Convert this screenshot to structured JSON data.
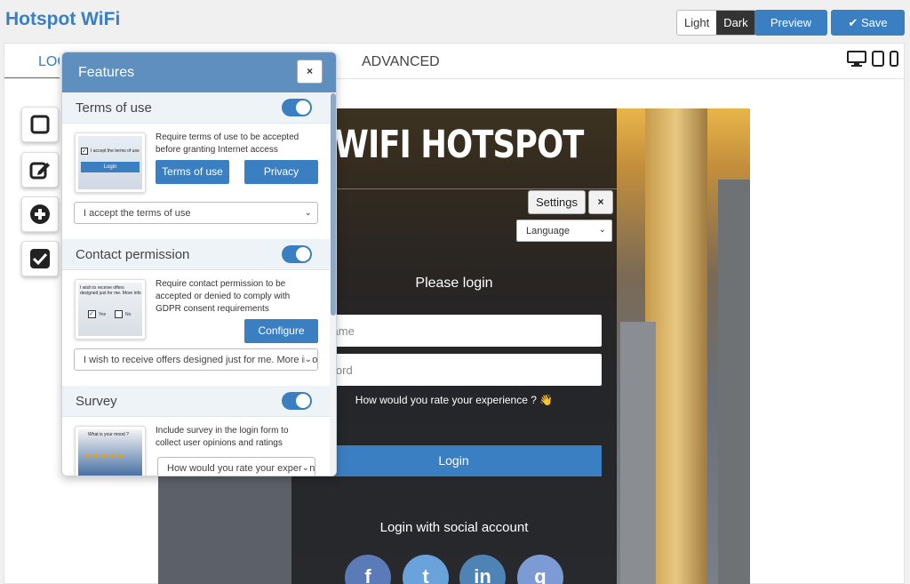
{
  "app": {
    "title": "Hotspot WiFi"
  },
  "theme": {
    "light": "Light",
    "dark": "Dark"
  },
  "toolbar": {
    "preview": "Preview",
    "save": "Save"
  },
  "tabs": {
    "login": "LOG",
    "advanced": "ADVANCED"
  },
  "preview": {
    "logo_text": "WIFI HOTSPOT",
    "settings": "Settings",
    "close": "×",
    "language": "Language",
    "please_login": "Please login",
    "username_placeholder": "rname",
    "password_placeholder": "sword",
    "rate_question": "How would you rate your experience ? 👋",
    "login_button": "Login",
    "social_title": "Login with social account",
    "social": [
      "f",
      "t",
      "in",
      "g"
    ]
  },
  "features": {
    "title": "Features",
    "close": "×",
    "sections": [
      {
        "title": "Terms of use",
        "description": "Require terms of use to be accepted before granting Internet access",
        "buttons": [
          "Terms of use",
          "Privacy"
        ],
        "select_value": "I accept the terms of use",
        "thumb_text": "I accept the terms of use",
        "thumb_button": "Login"
      },
      {
        "title": "Contact permission",
        "description": "Require contact permission to be accepted or denied to comply with GDPR consent requirements",
        "buttons": [
          "Configure"
        ],
        "select_value": "I wish to receive offers designed just for me. More info",
        "thumb_text": "I wish to receive offers designed just for me. More info",
        "thumb_yes": "Yes",
        "thumb_no": "No"
      },
      {
        "title": "Survey",
        "description": "Include survey in the login form to collect user opinions and ratings",
        "select_value": "How would you rate your experience",
        "thumb_text": "What is your mood ?"
      }
    ]
  },
  "colors": {
    "accent": "#3a7fc1",
    "header": "#5e8fbf"
  }
}
